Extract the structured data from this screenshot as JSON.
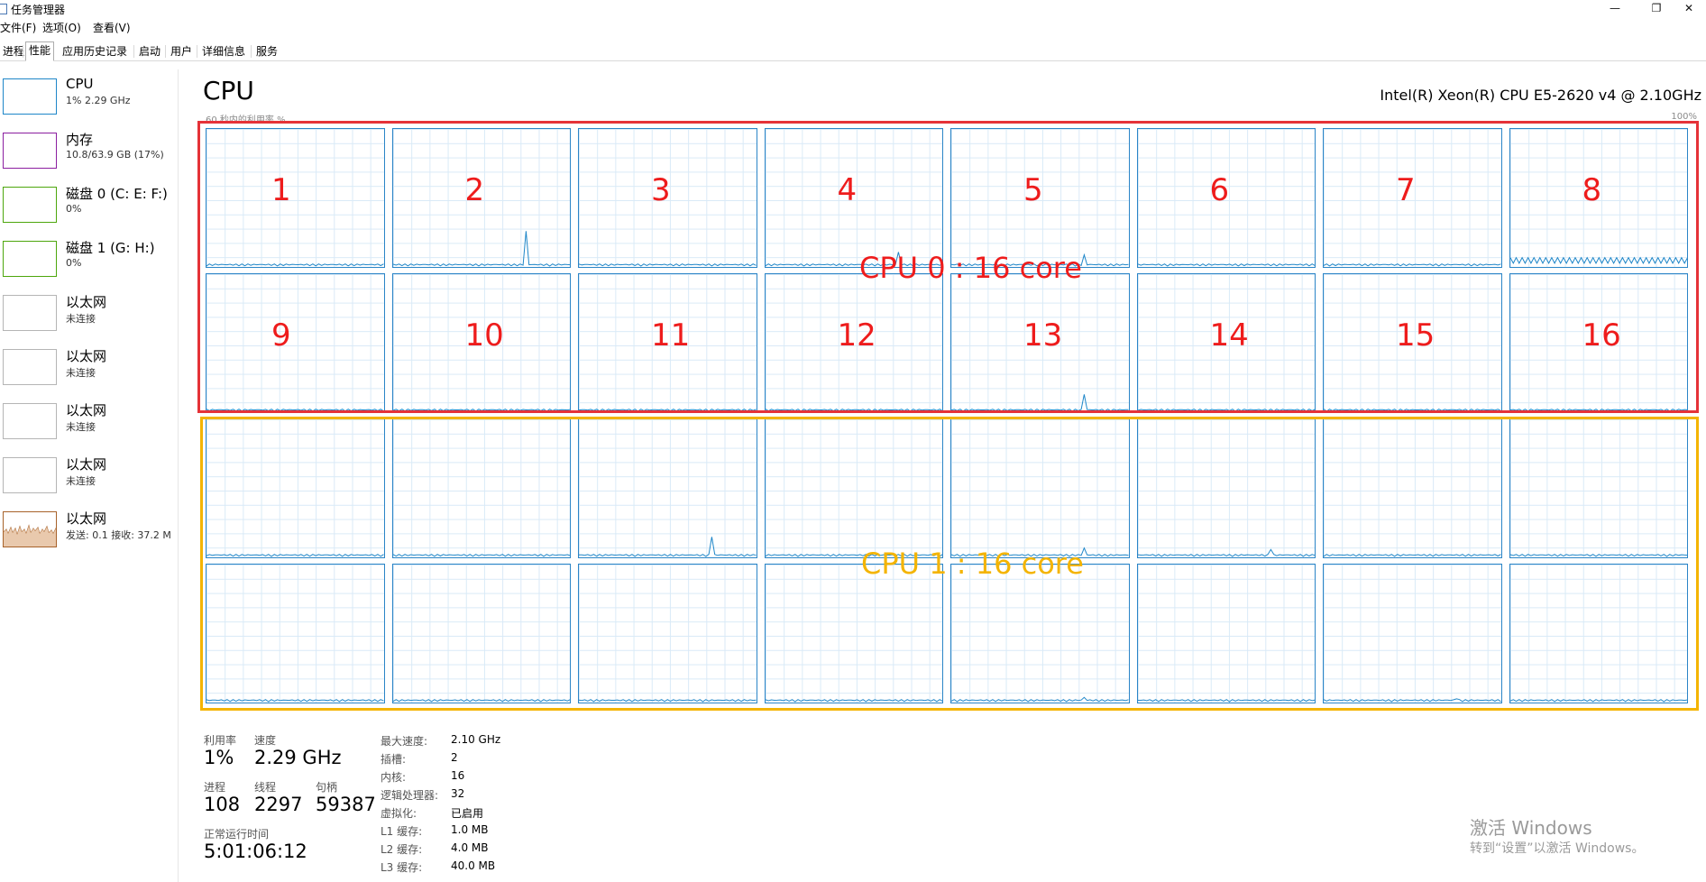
{
  "window": {
    "title": "任务管理器",
    "minimize_icon": "—",
    "restore_icon": "❐",
    "close_icon": "✕"
  },
  "menu": [
    "文件(F)",
    "选项(O)",
    "查看(V)"
  ],
  "tabs": [
    "进程",
    "性能",
    "应用历史记录",
    "启动",
    "用户",
    "详细信息",
    "服务"
  ],
  "active_tab": "性能",
  "sidebar": [
    {
      "title": "CPU",
      "sub": "1% 2.29 GHz",
      "color": "#1e86c8",
      "selected": true
    },
    {
      "title": "内存",
      "sub": "10.8/63.9 GB (17%)",
      "color": "#8b1ea0",
      "selected": false
    },
    {
      "title": "磁盘 0 (C: E: F:)",
      "sub": "0%",
      "color": "#4da60c",
      "selected": false
    },
    {
      "title": "磁盘 1 (G: H:)",
      "sub": "0%",
      "color": "#4da60c",
      "selected": false
    },
    {
      "title": "以太网",
      "sub": "未连接",
      "color": "#b5b5b5",
      "selected": false
    },
    {
      "title": "以太网",
      "sub": "未连接",
      "color": "#b5b5b5",
      "selected": false
    },
    {
      "title": "以太网",
      "sub": "未连接",
      "color": "#b5b5b5",
      "selected": false
    },
    {
      "title": "以太网",
      "sub": "未连接",
      "color": "#b5b5b5",
      "selected": false
    },
    {
      "title": "以太网",
      "sub": "发送: 0.1  接收: 37.2 M",
      "color": "#a7622a",
      "selected": false
    }
  ],
  "main": {
    "title": "CPU",
    "cpu_model": "Intel(R) Xeon(R) CPU E5-2620 v4 @ 2.10GHz",
    "axis_left": "60 秒内的利用率 %",
    "axis_right": "100%",
    "graph_color": "#1e86c8"
  },
  "annotations": {
    "cpu0_label": "CPU 0 : 16 core",
    "cpu1_label": "CPU 1 : 16 core",
    "core_numbers": [
      "1",
      "2",
      "3",
      "4",
      "5",
      "6",
      "7",
      "8",
      "9",
      "10",
      "11",
      "12",
      "13",
      "14",
      "15",
      "16"
    ],
    "red": "#e53238",
    "yellow": "#f4b400"
  },
  "stats": {
    "utilization_label": "利用率",
    "utilization": "1%",
    "speed_label": "速度",
    "speed": "2.29 GHz",
    "processes_label": "进程",
    "processes": "108",
    "threads_label": "线程",
    "threads": "2297",
    "handles_label": "句柄",
    "handles": "59387",
    "uptime_label": "正常运行时间",
    "uptime": "5:01:06:12"
  },
  "specs": [
    {
      "k": "最大速度:",
      "v": "2.10 GHz"
    },
    {
      "k": "插槽:",
      "v": "2"
    },
    {
      "k": "内核:",
      "v": "16"
    },
    {
      "k": "逻辑处理器:",
      "v": "32"
    },
    {
      "k": "虚拟化:",
      "v": "已启用"
    },
    {
      "k": "L1 缓存:",
      "v": "1.0 MB"
    },
    {
      "k": "L2 缓存:",
      "v": "4.0 MB"
    },
    {
      "k": "L3 缓存:",
      "v": "40.0 MB"
    }
  ],
  "watermark": {
    "line1": "激活 Windows",
    "line2": "转到“设置”以激活 Windows。"
  }
}
